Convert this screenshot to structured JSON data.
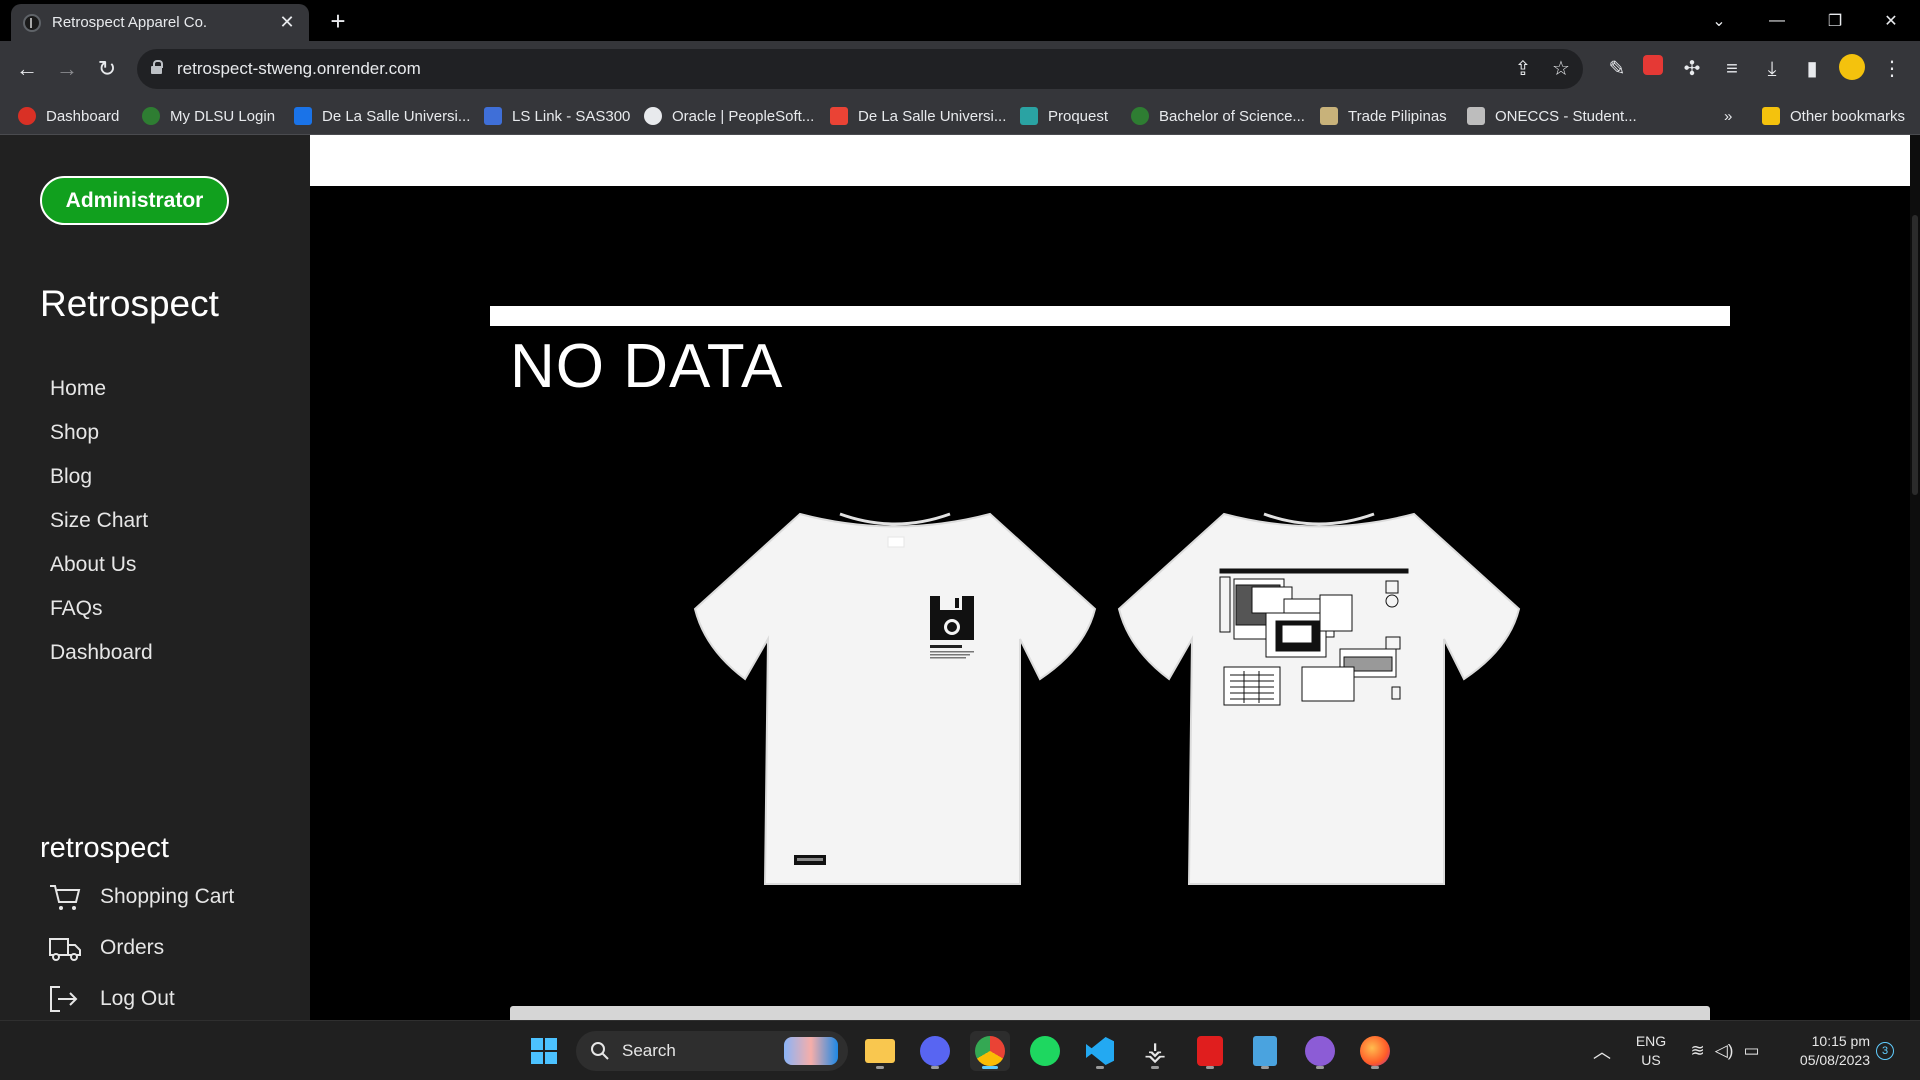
{
  "browser": {
    "tab_title": "Retrospect Apparel Co.",
    "new_tab": "+",
    "url": "retrospect-stweng.onrender.com",
    "bookmarks": [
      {
        "label": "Dashboard",
        "color": "#d93025"
      },
      {
        "label": "My DLSU Login",
        "color": "#2e7d32"
      },
      {
        "label": "De La Salle Universi...",
        "color": "#1a73e8"
      },
      {
        "label": "LS Link - SAS300",
        "color": "#3f6fd8"
      },
      {
        "label": "Oracle | PeopleSoft...",
        "color": "#e8eaed"
      },
      {
        "label": "De La Salle Universi...",
        "color": "#ea4335"
      },
      {
        "label": "Proquest",
        "color": "#2aa3a3"
      },
      {
        "label": "Bachelor of Science...",
        "color": "#2e7d32"
      },
      {
        "label": "Trade Pilipinas",
        "color": "#c8b27a"
      },
      {
        "label": "ONECCS - Student...",
        "color": "#bdbdbd"
      }
    ],
    "more_bookmarks": "»",
    "other_bookmarks": "Other bookmarks"
  },
  "sidebar": {
    "admin_button": "Administrator",
    "brand": "Retrospect",
    "nav": [
      "Home",
      "Shop",
      "Blog",
      "Size Chart",
      "About Us",
      "FAQs",
      "Dashboard"
    ],
    "brand_small": "retrospect",
    "shopping_cart": "Shopping Cart",
    "orders": "Orders",
    "logout": "Log Out"
  },
  "main": {
    "heading": "NO DATA",
    "products": [
      {
        "name": "floppy-disk-tee"
      },
      {
        "name": "desktop-windows-tee"
      }
    ]
  },
  "taskbar": {
    "search": "Search",
    "lang_top": "ENG",
    "lang_bottom": "US",
    "time": "10:15 pm",
    "date": "05/08/2023",
    "notifications": "3"
  },
  "colors": {
    "accent_green": "#11a01e",
    "sidebar_bg": "#212121",
    "page_bg": "#000000"
  }
}
